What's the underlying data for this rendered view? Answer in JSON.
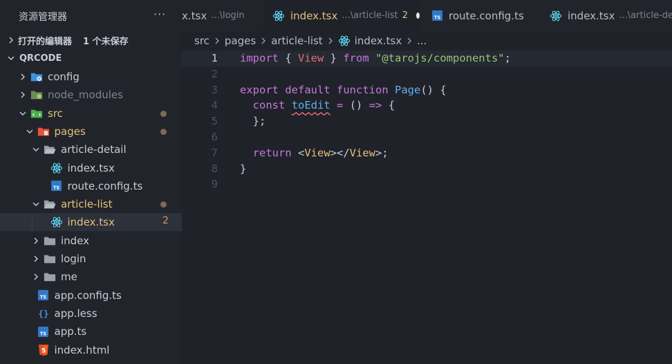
{
  "sidebar": {
    "title": "资源管理器",
    "more": "···",
    "open_editors": {
      "label": "打开的编辑器",
      "unsaved": "1 个未保存"
    },
    "workspace": "QRCODE",
    "tree": [
      {
        "label": "config",
        "icon": "config-folder-icon",
        "depth": 1,
        "chevron": "right"
      },
      {
        "label": "node_modules",
        "icon": "node-folder-icon",
        "depth": 1,
        "chevron": "right",
        "dim": true
      },
      {
        "label": "src",
        "icon": "src-folder-icon",
        "depth": 1,
        "chevron": "down",
        "modified": true
      },
      {
        "label": "pages",
        "icon": "pages-folder-icon",
        "depth": 2,
        "chevron": "down",
        "modified": true
      },
      {
        "label": "article-detail",
        "icon": "open-folder-icon",
        "depth": 3,
        "chevron": "down"
      },
      {
        "label": "index.tsx",
        "icon": "react-icon",
        "depth": 4
      },
      {
        "label": "route.config.ts",
        "icon": "ts-icon",
        "depth": 4
      },
      {
        "label": "article-list",
        "icon": "open-folder-icon",
        "depth": 3,
        "chevron": "down",
        "modified": true
      },
      {
        "label": "index.tsx",
        "icon": "react-icon",
        "depth": 4,
        "selected": true,
        "badge": "2"
      },
      {
        "label": "index",
        "icon": "folder-icon",
        "depth": 3,
        "chevron": "right"
      },
      {
        "label": "login",
        "icon": "folder-icon",
        "depth": 3,
        "chevron": "right"
      },
      {
        "label": "me",
        "icon": "folder-icon",
        "depth": 3,
        "chevron": "right"
      },
      {
        "label": "app.config.ts",
        "icon": "ts-icon",
        "depth": 2
      },
      {
        "label": "app.less",
        "icon": "less-icon",
        "depth": 2
      },
      {
        "label": "app.ts",
        "icon": "ts-icon",
        "depth": 2
      },
      {
        "label": "index.html",
        "icon": "html5-icon",
        "depth": 2
      }
    ]
  },
  "tabs": [
    {
      "name": "x.tsx",
      "desc": "...\\login",
      "icon": "none"
    },
    {
      "name": "index.tsx",
      "desc": "...\\article-list",
      "badge": "2",
      "icon": "react-icon",
      "active": true
    },
    {
      "name": "route.config.ts",
      "icon": "ts-icon"
    },
    {
      "name": "index.tsx",
      "desc": "...\\article-deta",
      "icon": "react-icon"
    }
  ],
  "breadcrumb": [
    "src",
    "pages",
    "article-list",
    "index.tsx",
    "..."
  ],
  "editor": {
    "line_numbers": [
      "1",
      "2",
      "3",
      "4",
      "5",
      "6",
      "7",
      "8",
      "9"
    ],
    "lines": [
      [
        [
          "kw",
          "import"
        ],
        [
          "pl",
          " { "
        ],
        [
          "ty",
          "View"
        ],
        [
          "pl",
          " } "
        ],
        [
          "kw",
          "from"
        ],
        [
          "pl",
          " "
        ],
        [
          "st",
          "\"@tarojs/components\""
        ],
        [
          "pl",
          ";"
        ]
      ],
      [],
      [
        [
          "kw",
          "export"
        ],
        [
          "pl",
          " "
        ],
        [
          "kw",
          "default"
        ],
        [
          "pl",
          " "
        ],
        [
          "kw",
          "function"
        ],
        [
          "pl",
          " "
        ],
        [
          "fn",
          "Page"
        ],
        [
          "pl",
          "() {"
        ]
      ],
      [
        [
          "pl",
          "  "
        ],
        [
          "kw",
          "const"
        ],
        [
          "pl",
          " "
        ],
        [
          "var",
          "toEdit"
        ],
        [
          "pl",
          " "
        ],
        [
          "kw",
          "="
        ],
        [
          "pl",
          " () "
        ],
        [
          "kw",
          "=>"
        ],
        [
          "pl",
          " {"
        ]
      ],
      [
        [
          "pl",
          "  };"
        ]
      ],
      [],
      [
        [
          "pl",
          "  "
        ],
        [
          "kw",
          "return"
        ],
        [
          "pl",
          " <"
        ],
        [
          "tg",
          "View"
        ],
        [
          "pl",
          "></"
        ],
        [
          "tg",
          "View"
        ],
        [
          "pl",
          ">;"
        ]
      ],
      [
        [
          "pl",
          "}"
        ]
      ],
      []
    ]
  },
  "colors": {
    "accent_modified": "#e5c07b",
    "react_blue": "#61dafb",
    "ts_blue": "#3178c6",
    "html_orange": "#e44d26",
    "selection_bg": "#2c313a"
  }
}
